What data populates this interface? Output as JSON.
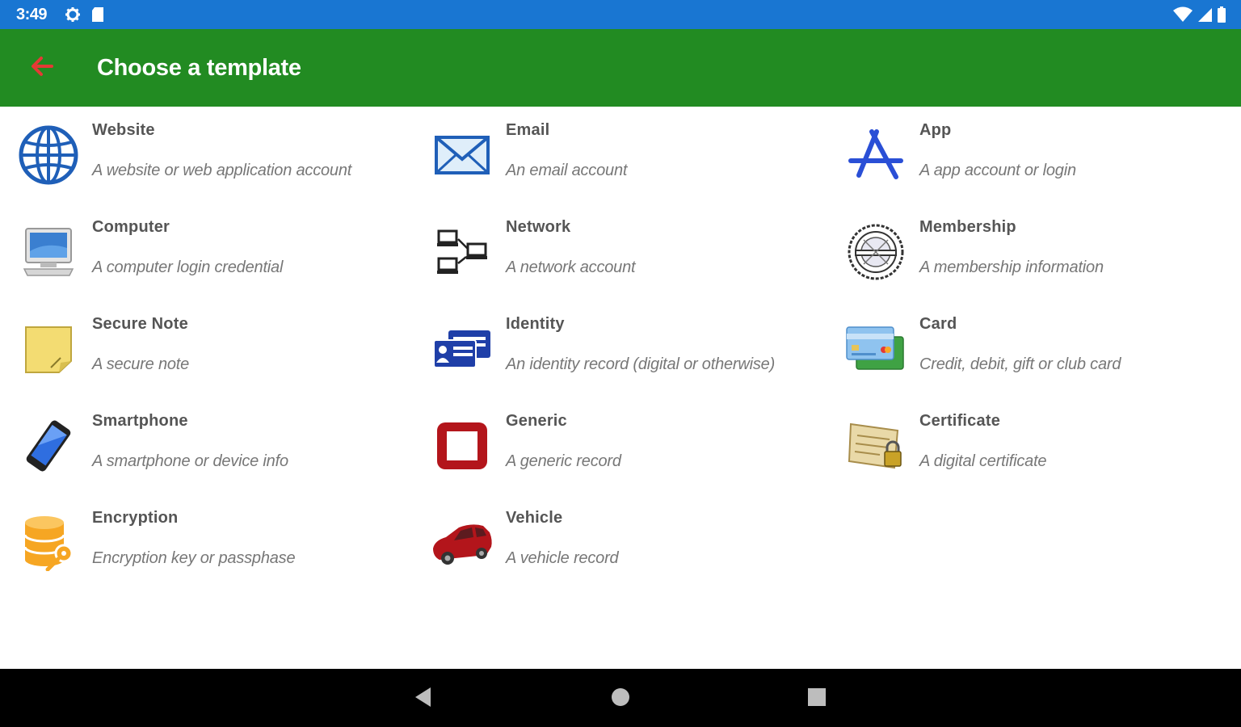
{
  "status_bar": {
    "time": "3:49",
    "icons": [
      "gear-icon",
      "sd-card-icon",
      "wifi-icon",
      "signal-icon",
      "battery-icon"
    ],
    "background": "#1976d2"
  },
  "app_bar": {
    "title": "Choose a template",
    "back_icon": "arrow-left-icon",
    "background": "#228b22",
    "back_color": "#e53935"
  },
  "templates": [
    {
      "title": "Website",
      "description": "A website or web application account",
      "icon": "globe-icon"
    },
    {
      "title": "Email",
      "description": "An email account",
      "icon": "envelope-icon"
    },
    {
      "title": "App",
      "description": "A app account or login",
      "icon": "app-store-icon"
    },
    {
      "title": "Computer",
      "description": "A computer login credential",
      "icon": "computer-icon"
    },
    {
      "title": "Network",
      "description": "A network account",
      "icon": "network-icon"
    },
    {
      "title": "Membership",
      "description": "A membership information",
      "icon": "membership-stamp-icon"
    },
    {
      "title": "Secure Note",
      "description": "A secure note",
      "icon": "sticky-note-icon"
    },
    {
      "title": "Identity",
      "description": "An identity record (digital or otherwise)",
      "icon": "id-card-icon"
    },
    {
      "title": "Card",
      "description": "Credit, debit, gift or club card",
      "icon": "credit-card-icon"
    },
    {
      "title": "Smartphone",
      "description": "A smartphone or device info",
      "icon": "smartphone-icon"
    },
    {
      "title": "Generic",
      "description": "A generic record",
      "icon": "generic-square-icon"
    },
    {
      "title": "Certificate",
      "description": "A digital certificate",
      "icon": "certificate-icon"
    },
    {
      "title": "Encryption",
      "description": "Encryption key or passphase",
      "icon": "database-key-icon"
    },
    {
      "title": "Vehicle",
      "description": "A vehicle record",
      "icon": "car-icon"
    }
  ],
  "nav_bar": {
    "icons": [
      "back-triangle-icon",
      "home-circle-icon",
      "recents-square-icon"
    ]
  }
}
